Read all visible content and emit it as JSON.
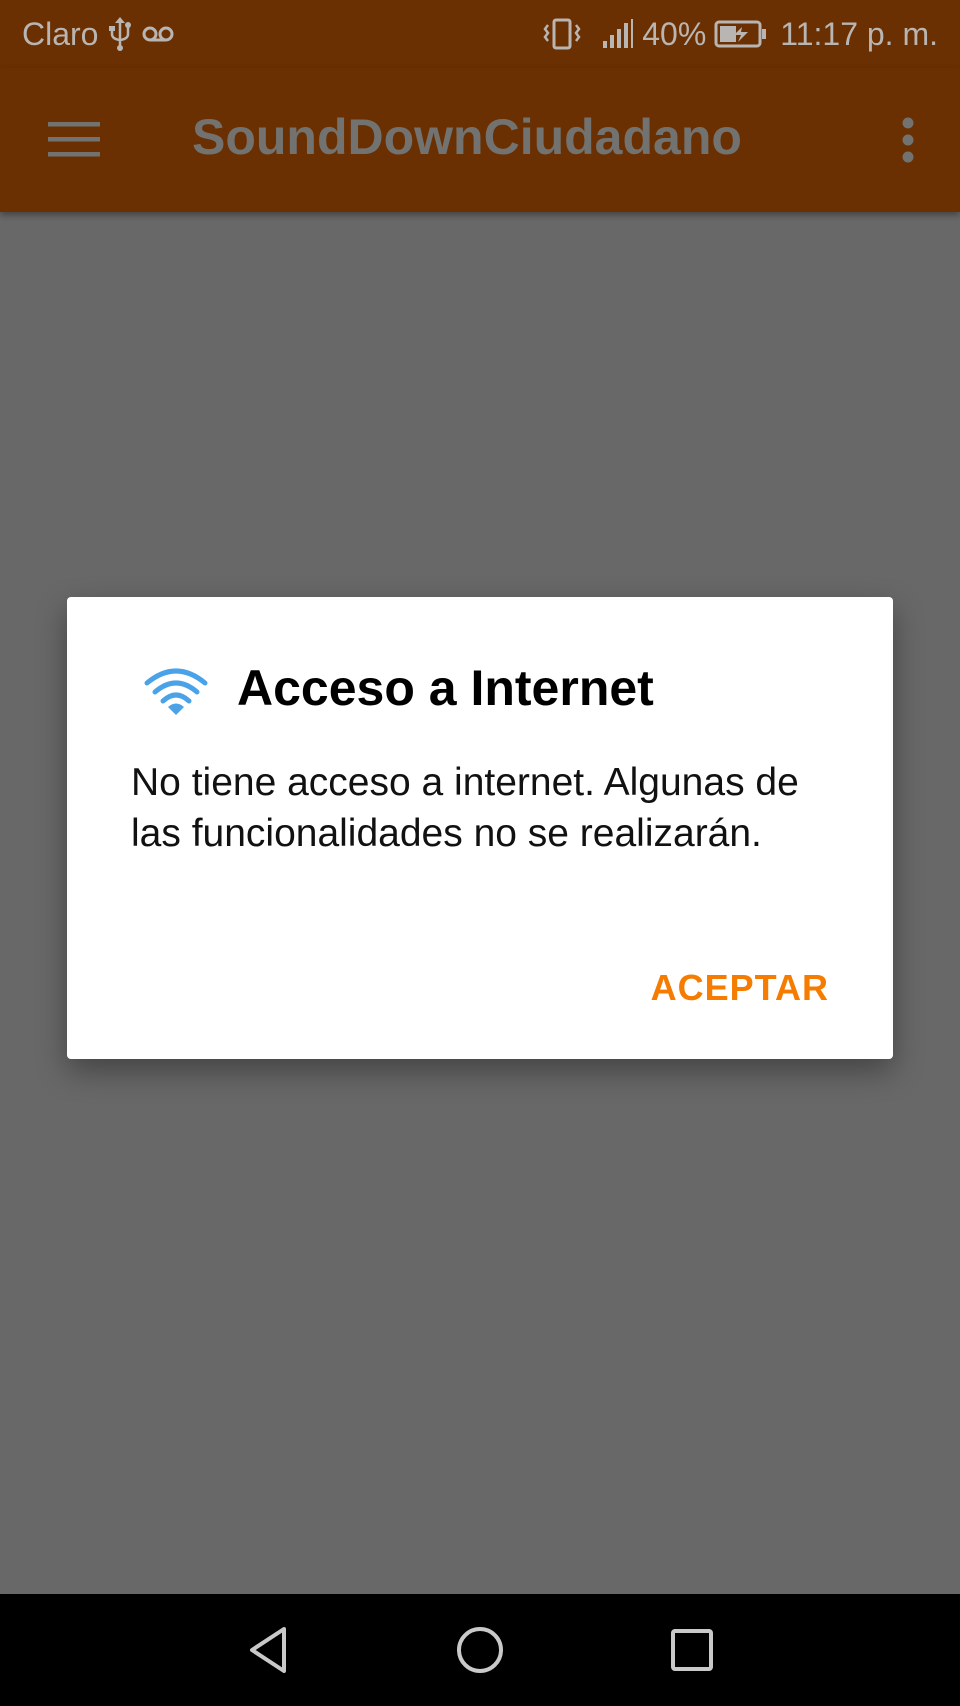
{
  "status_bar": {
    "carrier": "Claro",
    "battery_percent": "40%",
    "time": "11:17 p. m.",
    "icons": [
      "usb-icon",
      "voicemail-icon",
      "vibrate-icon",
      "signal-icon",
      "battery-charging-icon"
    ]
  },
  "toolbar": {
    "title": "SoundDownCiudadano",
    "menu_icon": "hamburger-menu-icon",
    "overflow_icon": "more-vert-icon"
  },
  "dialog": {
    "title": "Acceso a Internet",
    "icon": "wifi-icon",
    "message": "No tiene acceso a internet. Algunas de las funcionalidades no se realizarán.",
    "accept_label": "ACEPTAR",
    "accent_color": "#f57c00"
  },
  "navigation_bar": {
    "buttons": [
      "back-icon",
      "home-icon",
      "recents-icon"
    ]
  },
  "colors": {
    "toolbar": "#6a3002",
    "scrim": "#686868",
    "wifi": "#4aa3e8"
  }
}
